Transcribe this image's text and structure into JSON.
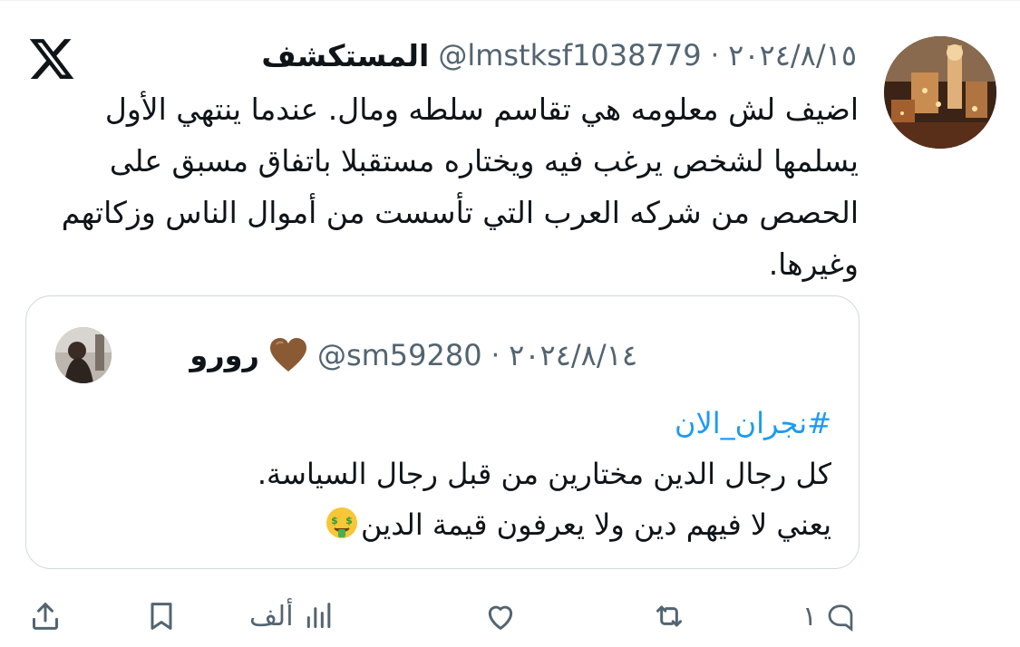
{
  "tweet": {
    "author_name": "المستكشف",
    "handle": "@lmstksf1038779",
    "separator": "·",
    "date": "٢٠٢٤/٨/١٥",
    "text": "اضيف لش معلومه هي تقاسم سلطه ومال. عندما ينتهي الأول يسلمها لشخص يرغب فيه ويختاره مستقبلا باتفاق مسبق على الحصص من شركه العرب التي تأسست من أموال الناس وزكاتهم وغيرها."
  },
  "quote": {
    "author_name": "رورو",
    "name_emoji": "brown-heart-icon",
    "handle": "@sm59280",
    "separator": "·",
    "date": "٢٠٢٤/٨/١٤",
    "hashtag": "#نجران_الان",
    "line1": "كل رجال الدين مختارين من قبل رجال السياسة.",
    "line2": "يعني لا فيهم دين ولا يعرفون قيمة الدين",
    "line2_emoji": "money-mouth-face-icon"
  },
  "actions": {
    "reply_count": "١",
    "retweet_count": "",
    "like_count": "",
    "views_count": "ألف",
    "bookmark_count": "",
    "share_count": ""
  },
  "colors": {
    "text": "#0f1419",
    "secondary": "#536471",
    "link": "#1d9bf0",
    "border": "#cfd9de"
  }
}
